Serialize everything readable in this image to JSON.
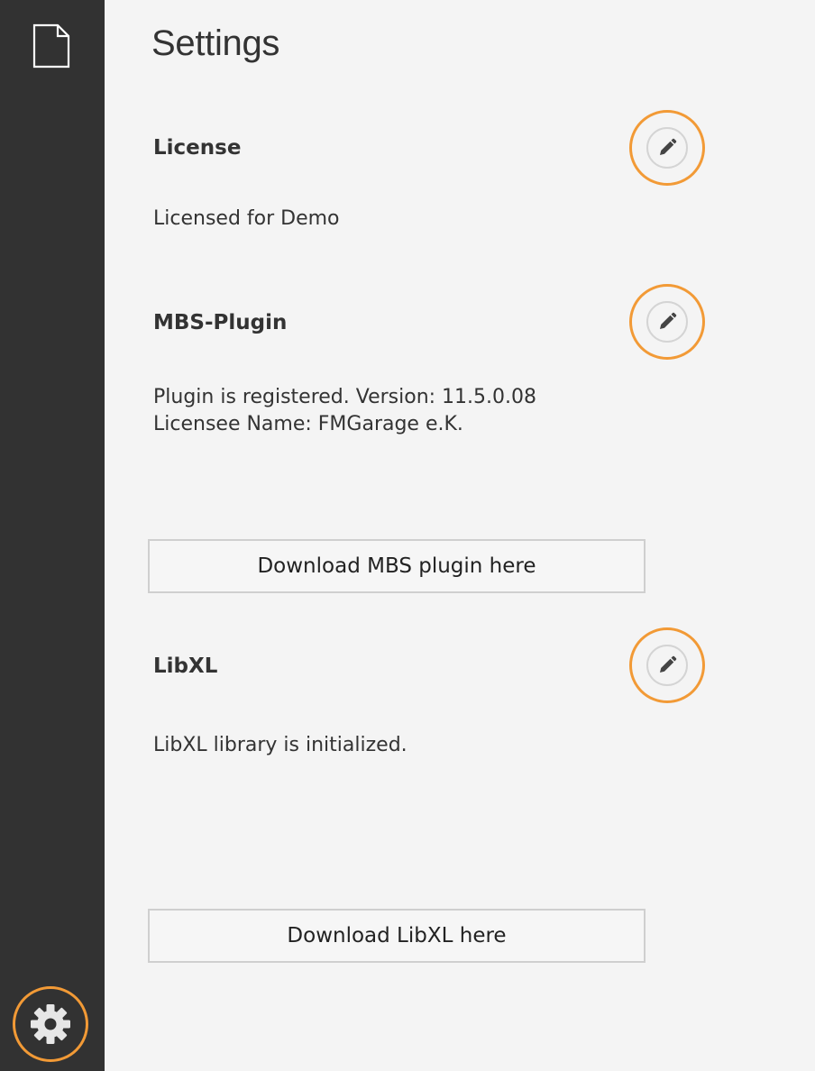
{
  "sidebar": {
    "document_icon": "document-icon",
    "settings_icon": "gear-icon"
  },
  "page": {
    "title": "Settings"
  },
  "sections": {
    "license": {
      "title": "License",
      "text": "Licensed for Demo",
      "edit_icon": "pencil-icon"
    },
    "mbs_plugin": {
      "title": "MBS-Plugin",
      "text_line1": "Plugin is registered. Version: 11.5.0.08",
      "text_line2": "Licensee Name: FMGarage e.K.",
      "edit_icon": "pencil-icon",
      "download_label": "Download MBS plugin here"
    },
    "libxl": {
      "title": "LibXL",
      "text": "LibXL library is initialized.",
      "edit_icon": "pencil-icon",
      "download_label": "Download LibXL here"
    }
  },
  "colors": {
    "sidebar_bg": "#323232",
    "content_bg": "#f4f4f4",
    "accent": "#f29a36",
    "text": "#333333"
  }
}
